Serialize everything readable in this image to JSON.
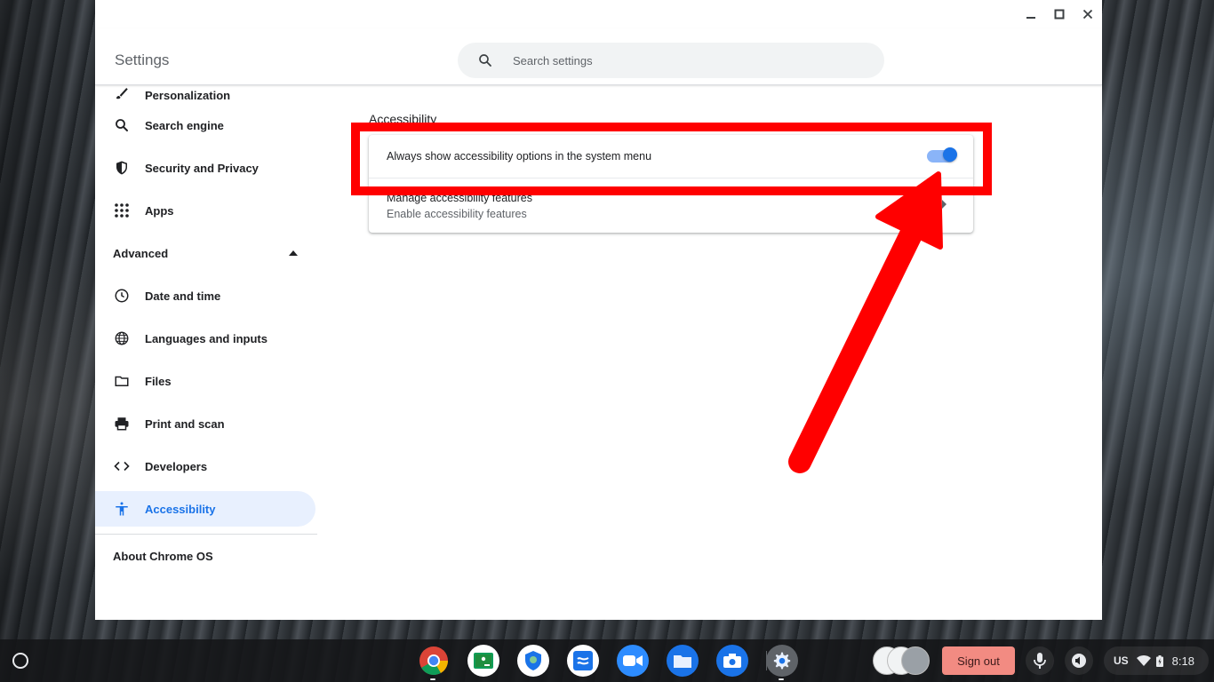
{
  "window": {
    "title": "Settings",
    "controls": {
      "minimize": "–",
      "maximize": "▢",
      "close": "✕"
    }
  },
  "search": {
    "placeholder": "Search settings",
    "value": ""
  },
  "sidebar": {
    "items": [
      {
        "label": "Personalization",
        "icon": "brush-icon"
      },
      {
        "label": "Search engine",
        "icon": "search-icon"
      },
      {
        "label": "Security and Privacy",
        "icon": "shield-icon"
      },
      {
        "label": "Apps",
        "icon": "apps-grid-icon"
      }
    ],
    "advanced_label": "Advanced",
    "advanced_items": [
      {
        "label": "Date and time",
        "icon": "clock-icon"
      },
      {
        "label": "Languages and inputs",
        "icon": "globe-icon"
      },
      {
        "label": "Files",
        "icon": "folder-icon"
      },
      {
        "label": "Print and scan",
        "icon": "printer-icon"
      },
      {
        "label": "Developers",
        "icon": "code-icon"
      },
      {
        "label": "Accessibility",
        "icon": "accessibility-icon",
        "active": true
      }
    ],
    "about_label": "About Chrome OS"
  },
  "main": {
    "heading": "Accessibility",
    "toggle_row": {
      "label": "Always show accessibility options in the system menu",
      "enabled": true
    },
    "link_row": {
      "title": "Manage accessibility features",
      "subtitle": "Enable accessibility features"
    }
  },
  "shelf": {
    "apps": [
      "chrome-icon",
      "classroom-icon",
      "security-app-icon",
      "notes-app-icon",
      "zoom-icon",
      "files-icon",
      "camera-icon",
      "settings-icon"
    ],
    "sign_out_label": "Sign out",
    "lang": "US",
    "time": "8:18"
  },
  "colors": {
    "accent": "#1a73e8",
    "toggle_track": "#8ab4f8",
    "highlight": "#ff0000",
    "sign_out_bg": "#f28b82"
  }
}
